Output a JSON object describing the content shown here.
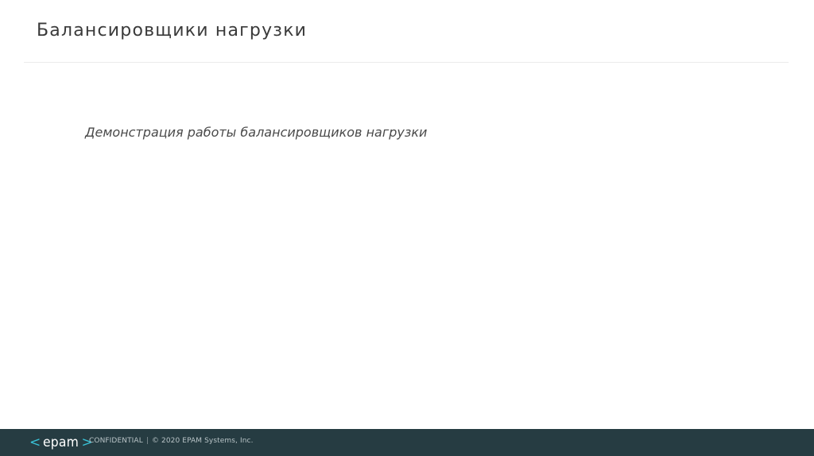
{
  "slide": {
    "title": "Балансировщики нагрузки",
    "body_text": "Демонстрация работы балансировщиков нагрузки"
  },
  "footer": {
    "logo": {
      "left_bracket": "<",
      "word": "epam",
      "right_bracket": ">"
    },
    "confidential_label": "CONFIDENTIAL",
    "separator": "|",
    "copyright": "© 2020 EPAM Systems, Inc."
  },
  "colors": {
    "footer_background": "#263c42",
    "logo_accent": "#39c2d7",
    "title_text": "#3a3a3a"
  }
}
